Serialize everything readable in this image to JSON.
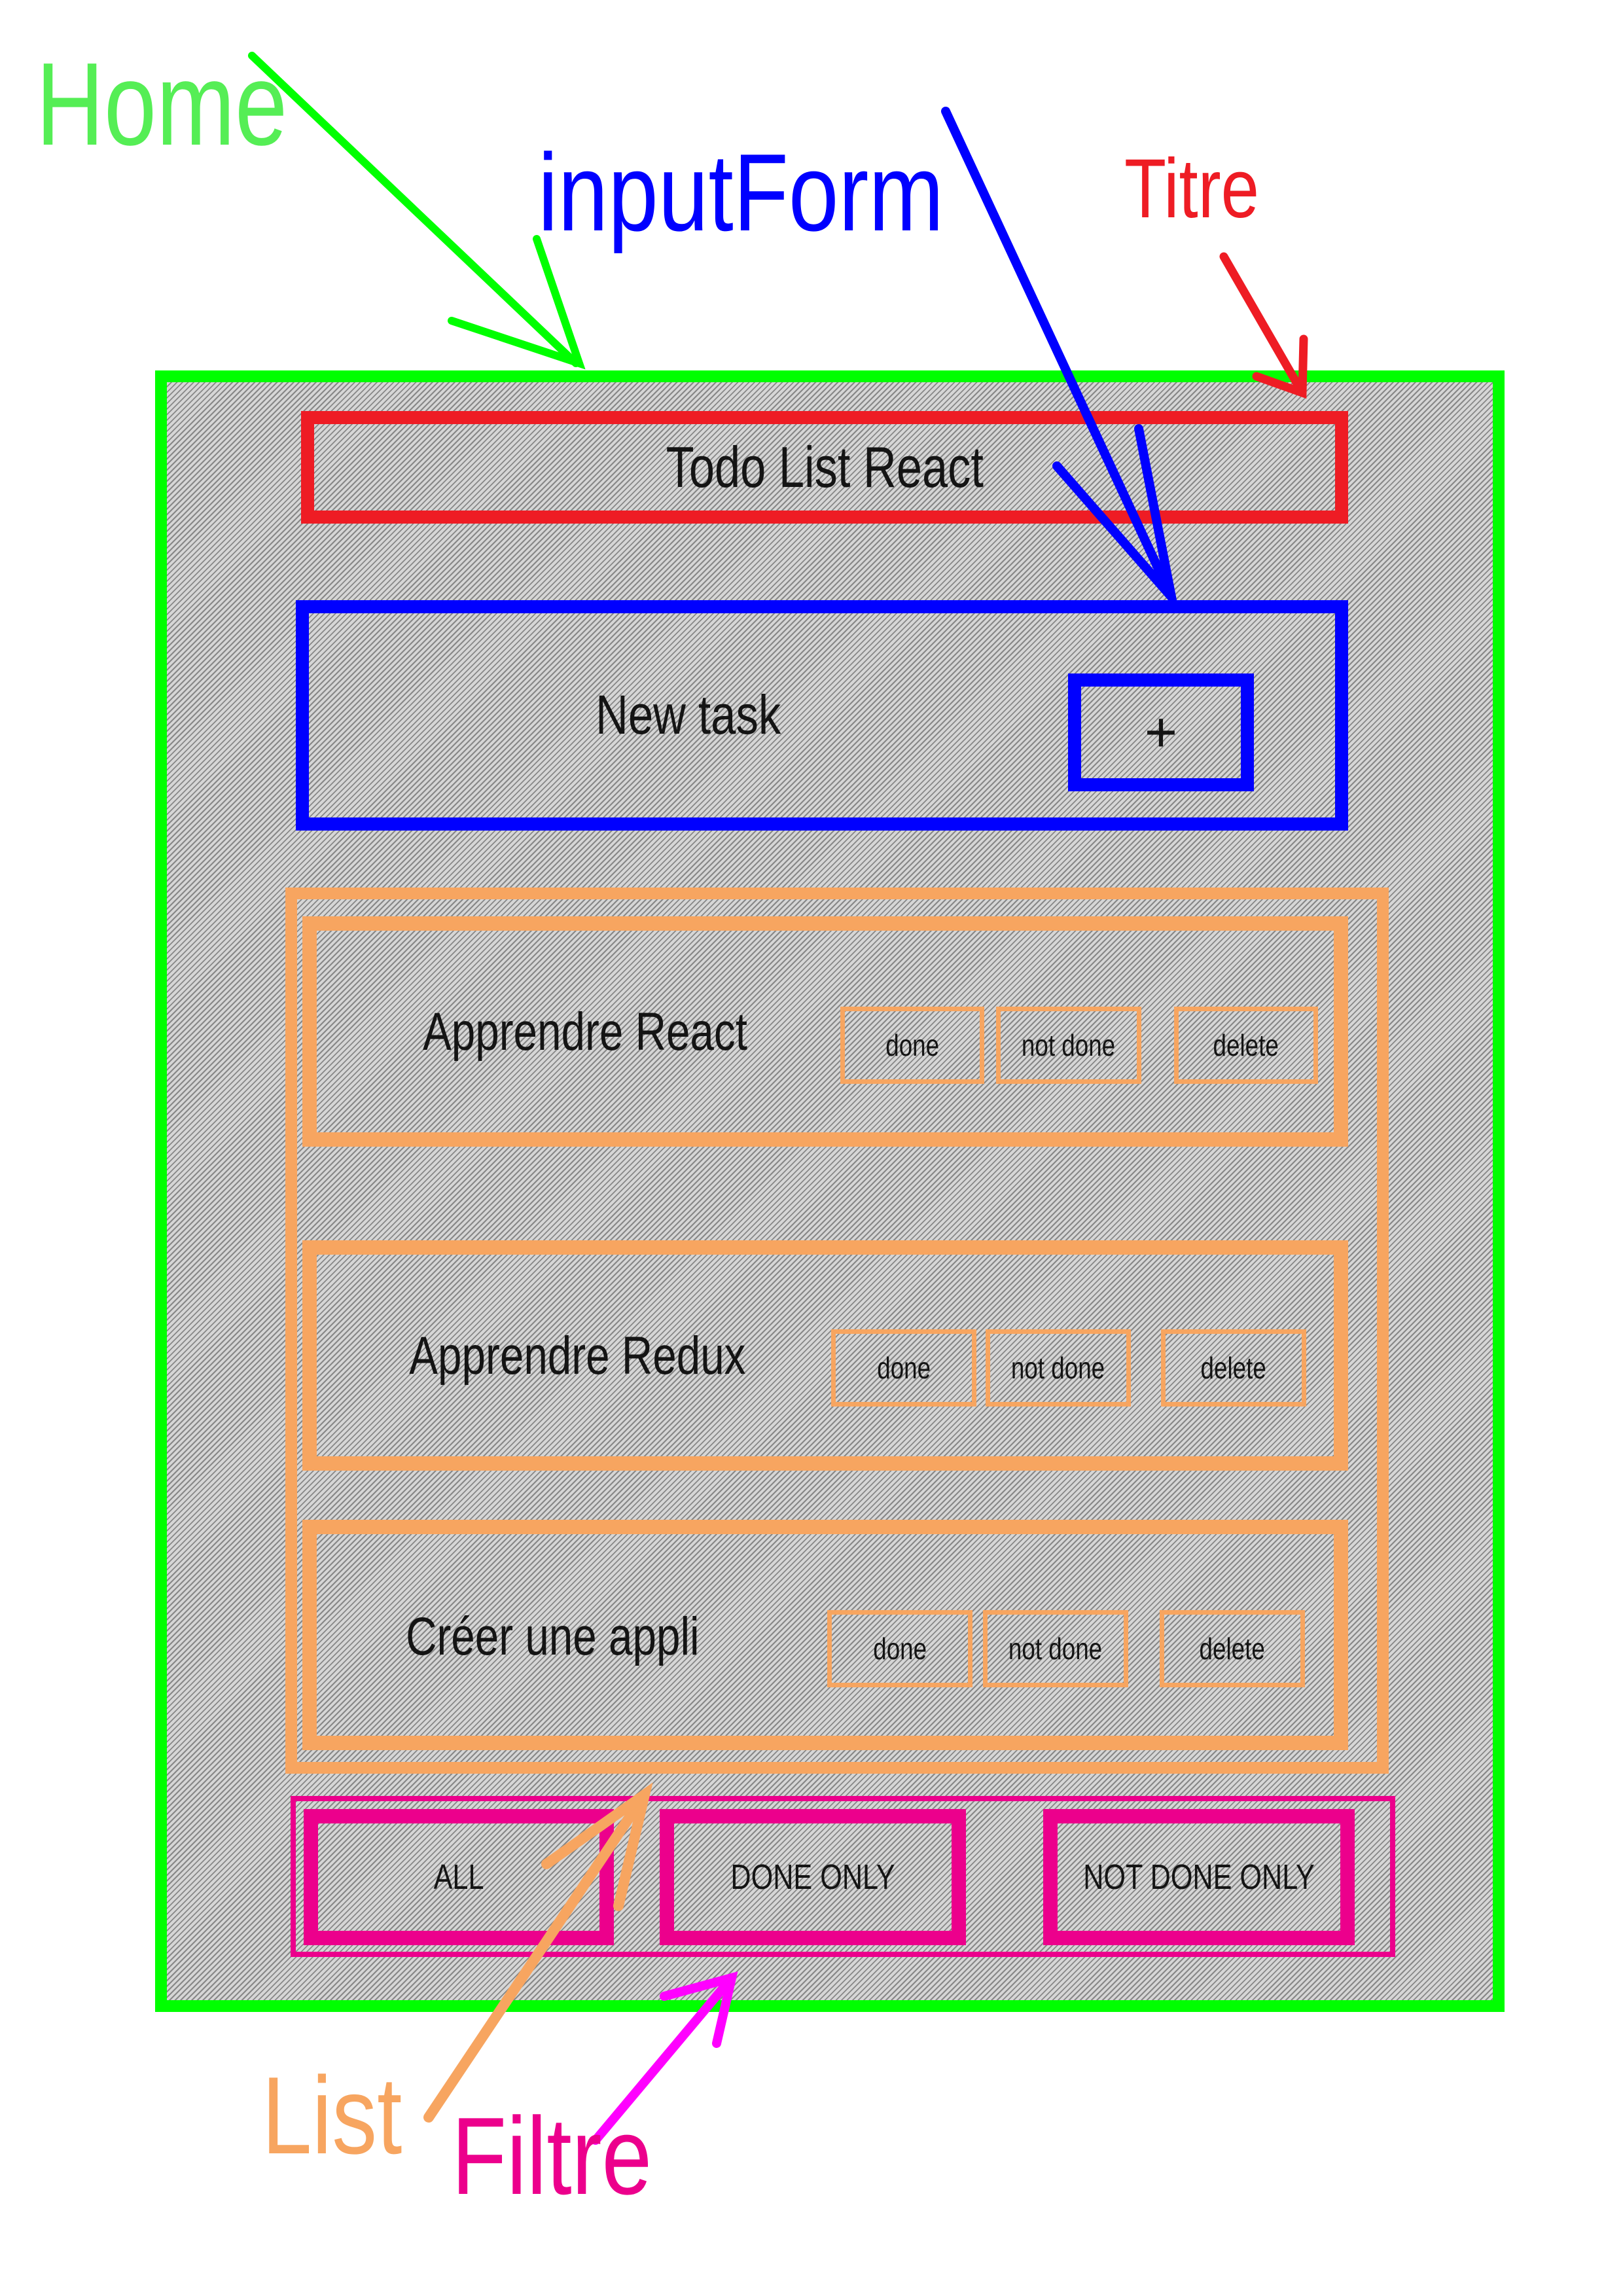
{
  "labels": {
    "home": "Home",
    "input_form": "inputForm",
    "titre": "Titre",
    "list": "List",
    "filtre": "Filtre"
  },
  "titre_box": {
    "text": "Todo List React"
  },
  "input_form": {
    "placeholder": "New task",
    "add_button": "+"
  },
  "list": {
    "tasks": [
      {
        "name": "Apprendre React",
        "done": "done",
        "not_done": "not done",
        "delete": "delete"
      },
      {
        "name": "Apprendre Redux",
        "done": "done",
        "not_done": "not done",
        "delete": "delete"
      },
      {
        "name": "Créer une appli",
        "done": "done",
        "not_done": "not done",
        "delete": "delete"
      }
    ]
  },
  "filtre": {
    "all": "ALL",
    "done_only": "DONE ONLY",
    "not_done_only": "NOT DONE ONLY"
  },
  "colors": {
    "home": "#00ff00",
    "home_label": "#55ee55",
    "input_form": "#0000ff",
    "titre": "#ee1c24",
    "list": "#f7a560",
    "filtre": "#ec008c",
    "filtre_arrow": "#ff00ff"
  }
}
